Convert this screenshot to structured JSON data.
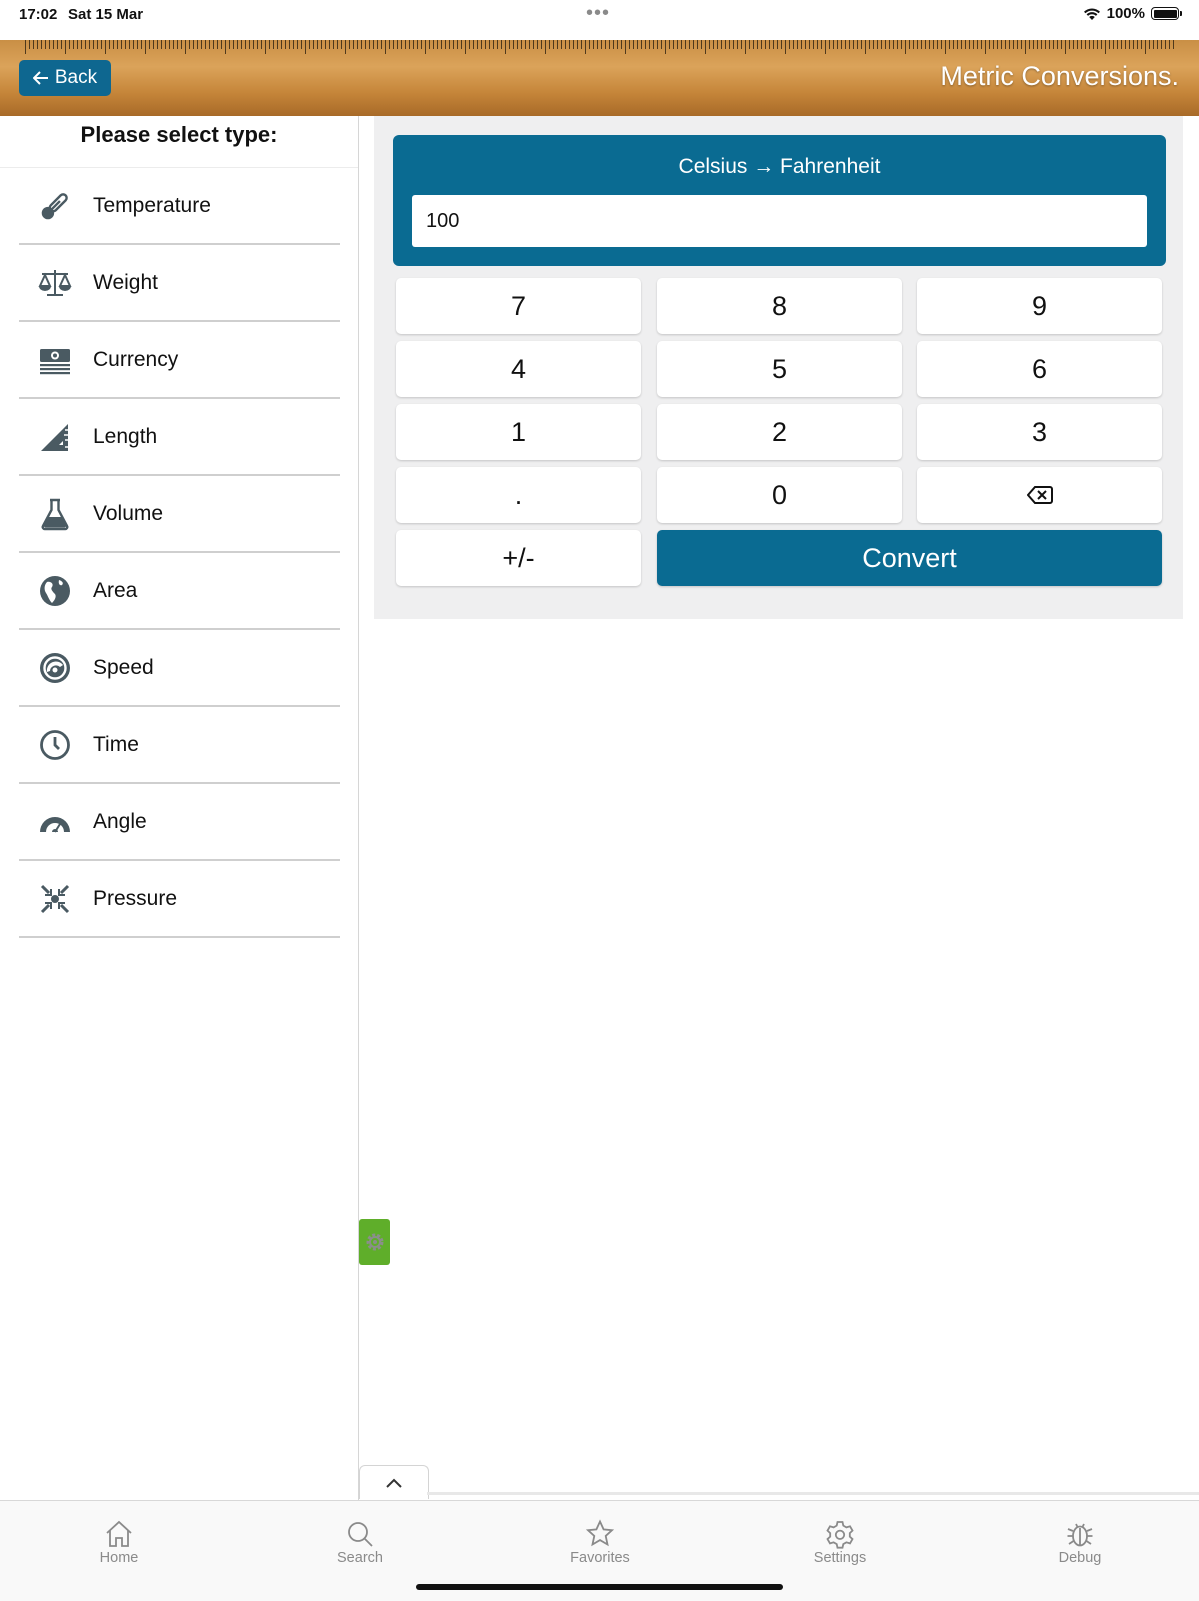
{
  "status_bar": {
    "time": "17:02",
    "date": "Sat 15 Mar",
    "dots": "•••",
    "battery": "100%"
  },
  "header": {
    "back_label": "Back",
    "title": "Metric Conversions."
  },
  "sidebar": {
    "title": "Please select type:",
    "items": [
      {
        "label": "Temperature",
        "icon": "thermometer-icon"
      },
      {
        "label": "Weight",
        "icon": "scale-icon"
      },
      {
        "label": "Currency",
        "icon": "money-icon"
      },
      {
        "label": "Length",
        "icon": "ruler-triangle-icon"
      },
      {
        "label": "Volume",
        "icon": "flask-icon"
      },
      {
        "label": "Area",
        "icon": "globe-icon"
      },
      {
        "label": "Speed",
        "icon": "speedometer-icon"
      },
      {
        "label": "Time",
        "icon": "clock-icon"
      },
      {
        "label": "Angle",
        "icon": "protractor-icon"
      },
      {
        "label": "Pressure",
        "icon": "compress-icon"
      }
    ]
  },
  "converter": {
    "title": "Celsius → Fahrenheit",
    "input_value": "100",
    "keys": {
      "k7": "7",
      "k8": "8",
      "k9": "9",
      "k4": "4",
      "k5": "5",
      "k6": "6",
      "k1": "1",
      "k2": "2",
      "k3": "3",
      "dot": ".",
      "k0": "0",
      "sign": "+/-",
      "convert": "Convert"
    }
  },
  "tabs": {
    "home": "Home",
    "search": "Search",
    "favorites": "Favorites",
    "settings": "Settings",
    "debug": "Debug"
  },
  "colors": {
    "primary": "#0a6b92",
    "header_wood": "#c98f45",
    "panel_bg": "#efeff0",
    "gear_tab": "#5fae2a",
    "icon_gray": "#4a5a62"
  }
}
